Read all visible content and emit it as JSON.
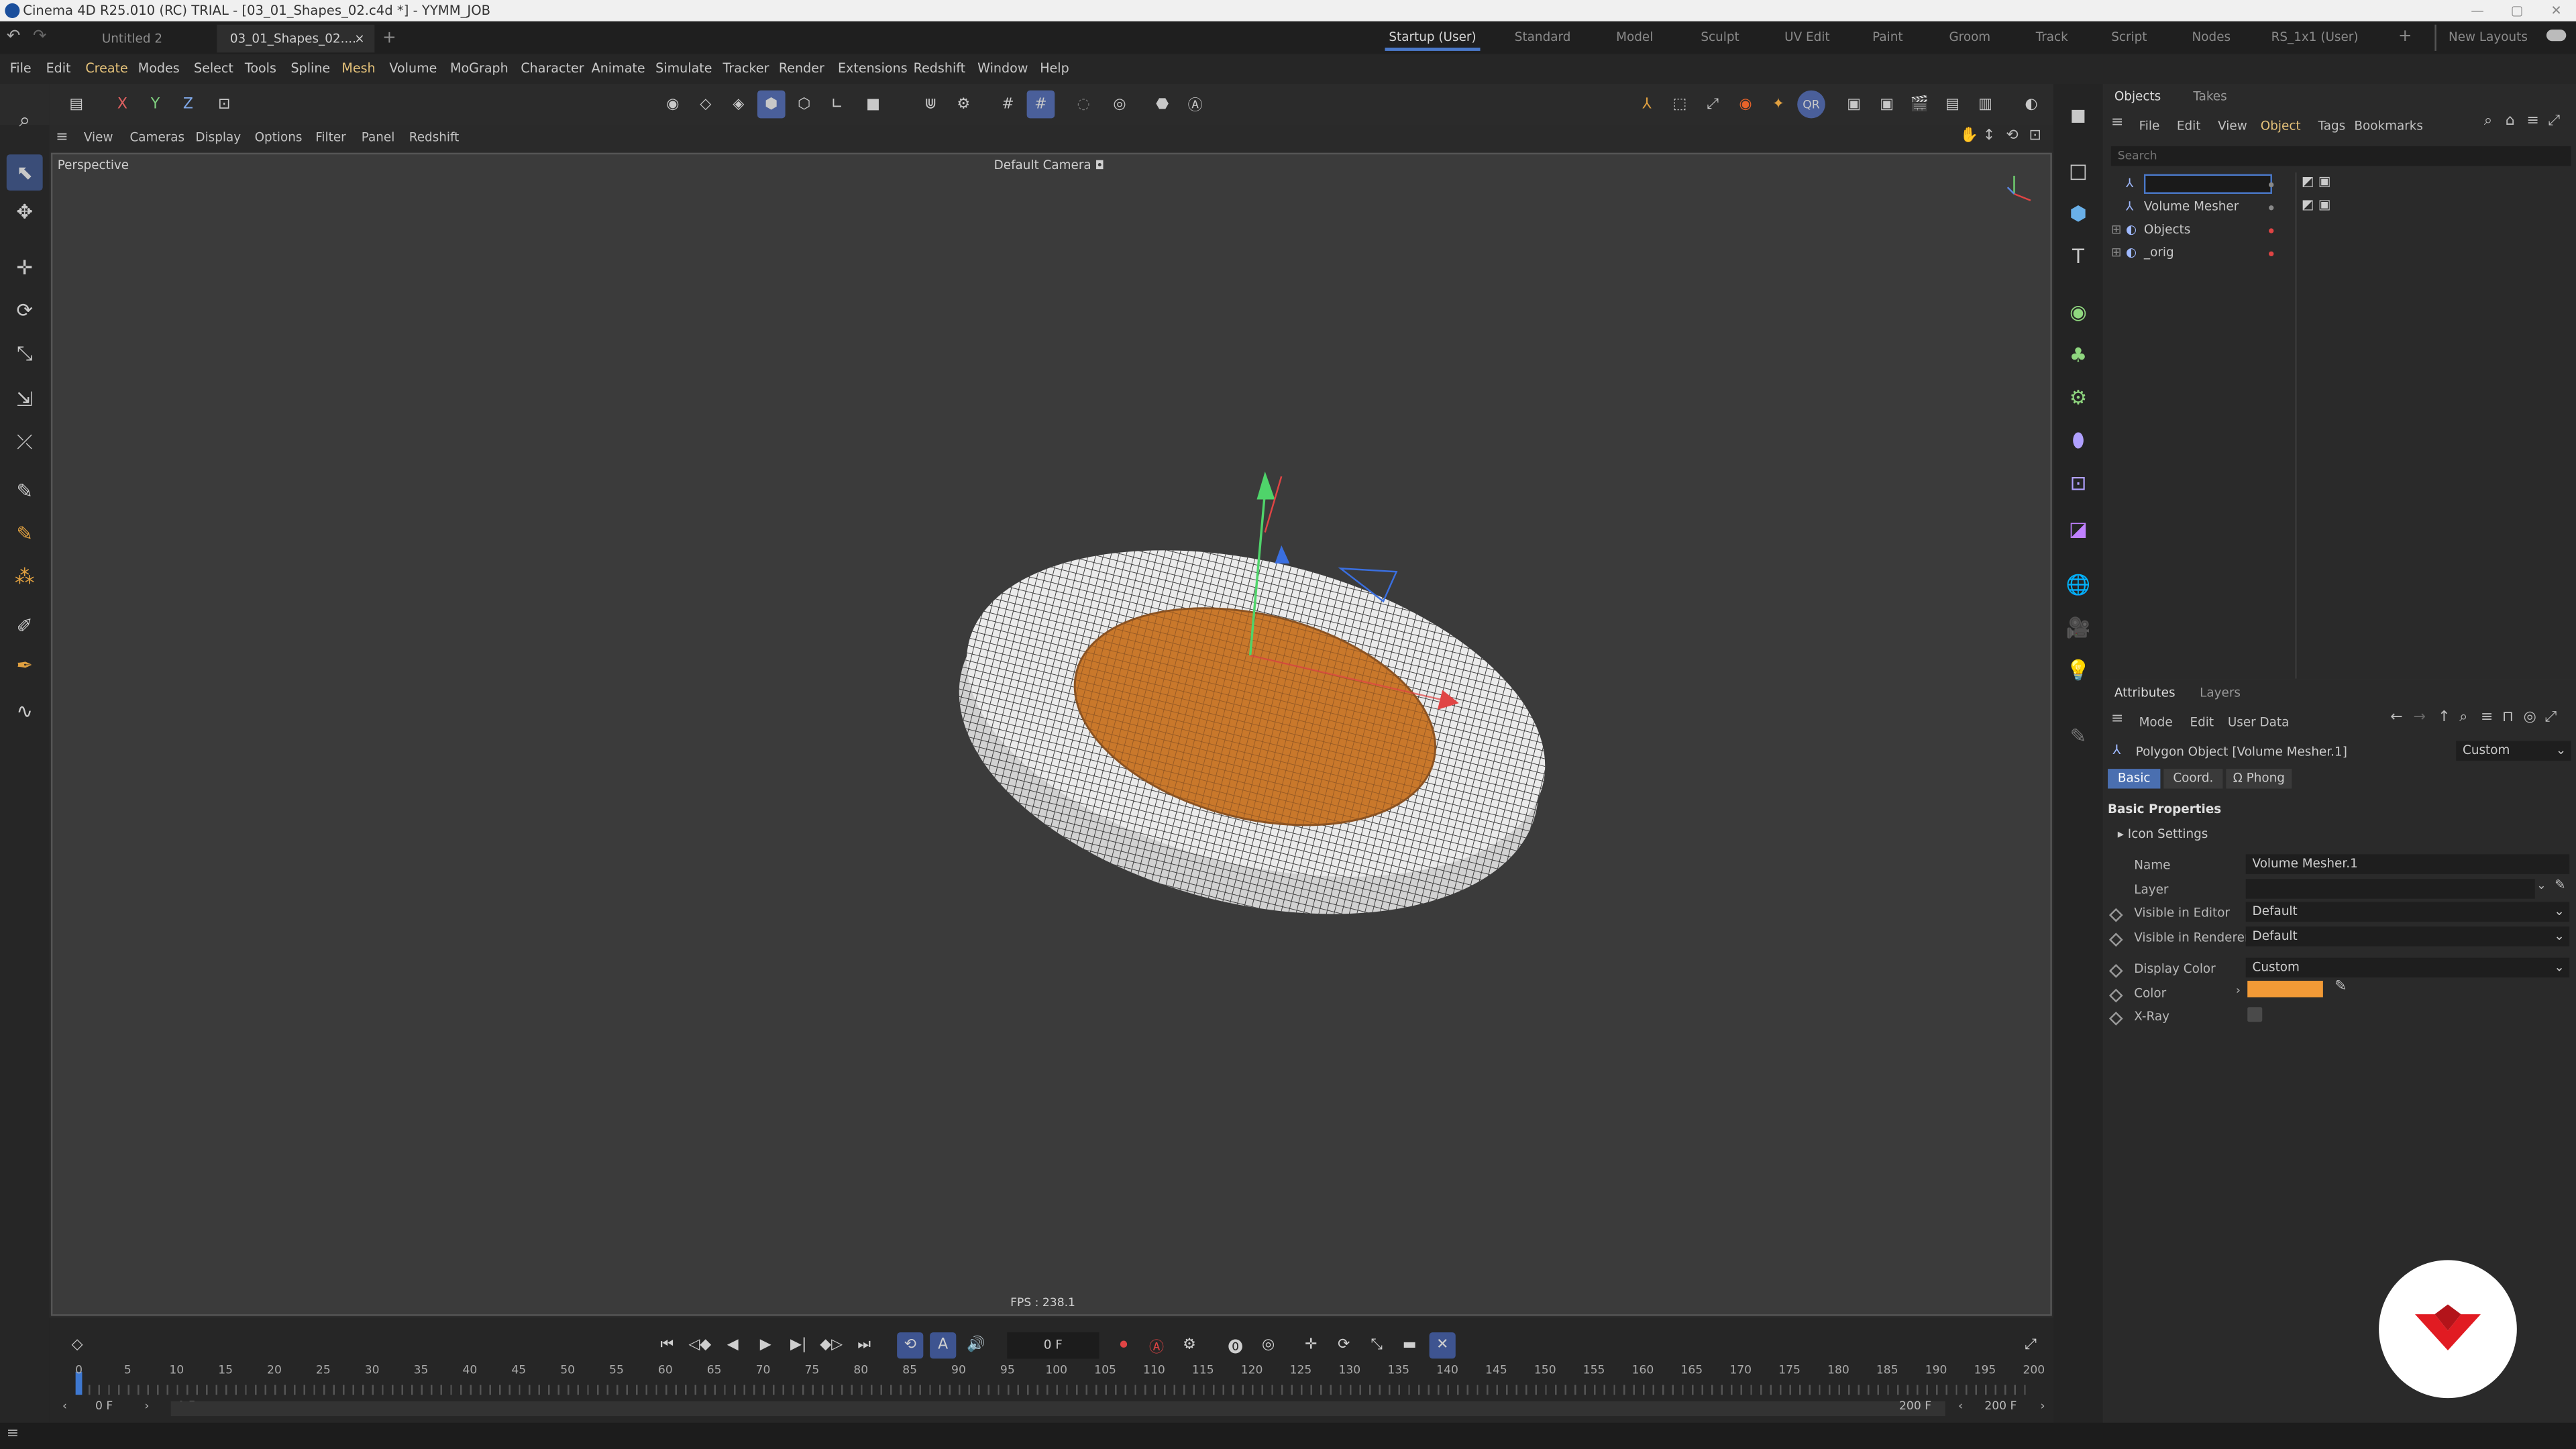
{
  "app": {
    "title": "Cinema 4D R25.010 (RC) TRIAL - [03_01_Shapes_02.c4d *] - YYMM_JOB"
  },
  "doc_tabs": [
    "Untitled 2",
    "03_01_Shapes_02....",
    "×",
    "+"
  ],
  "layouts": [
    "Startup (User)",
    "Standard",
    "Model",
    "Sculpt",
    "UV Edit",
    "Paint",
    "Groom",
    "Track",
    "Script",
    "Nodes",
    "RS_1x1 (User)",
    "+",
    "New Layouts"
  ],
  "menu": [
    "File",
    "Edit",
    "Create",
    "Modes",
    "Select",
    "Tools",
    "Spline",
    "Mesh",
    "Volume",
    "MoGraph",
    "Character",
    "Animate",
    "Simulate",
    "Tracker",
    "Render",
    "Extensions",
    "Redshift",
    "Window",
    "Help"
  ],
  "axis_toggles": [
    "X",
    "Y",
    "Z"
  ],
  "viewport": {
    "menu": [
      "View",
      "Cameras",
      "Display",
      "Options",
      "Filter",
      "Panel",
      "Redshift"
    ],
    "label": "Perspective",
    "camera": "Default Camera",
    "fps": "FPS : 238.1",
    "accent_orange": "#c9782b",
    "mesh_color": "#e8e8e8"
  },
  "timeline": {
    "frame_display": "0 F",
    "start": "0 F",
    "start2": "0 F",
    "end": "200 F",
    "end2": "200 F",
    "ticks": [
      "0",
      "5",
      "10",
      "15",
      "20",
      "25",
      "30",
      "35",
      "40",
      "45",
      "50",
      "55",
      "60",
      "65",
      "70",
      "75",
      "80",
      "85",
      "90",
      "95",
      "100",
      "105",
      "110",
      "115",
      "120",
      "125",
      "130",
      "135",
      "140",
      "145",
      "150",
      "155",
      "160",
      "165",
      "170",
      "175",
      "180",
      "185",
      "190",
      "195",
      "200"
    ]
  },
  "objects_panel": {
    "tabs": [
      "Objects",
      "Takes"
    ],
    "menu": [
      "File",
      "Edit",
      "View",
      "Object",
      "Tags",
      "Bookmarks"
    ],
    "search_placeholder": "Search",
    "rows": [
      {
        "name": ""
      },
      {
        "name": "Volume Mesher"
      },
      {
        "name": "Objects"
      },
      {
        "name": "_orig"
      }
    ]
  },
  "attributes_panel": {
    "tabs": [
      "Attributes",
      "Layers"
    ],
    "menu": [
      "Mode",
      "Edit",
      "User Data"
    ],
    "object_title": "Polygon Object [Volume Mesher.1]",
    "preset": "Custom",
    "subtabs": [
      "Basic",
      "Coord.",
      "Phong"
    ],
    "section": "Basic Properties",
    "icon_settings": "Icon Settings",
    "fields": {
      "name_label": "Name",
      "name_value": "Volume Mesher.1",
      "layer_label": "Layer",
      "layer_value": "",
      "vis_editor_label": "Visible in Editor",
      "vis_editor_value": "Default",
      "vis_render_label": "Visible in Renderer",
      "vis_render_value": "Default",
      "display_color_label": "Display Color",
      "display_color_value": "Custom",
      "color_label": "Color",
      "color_swatch": "#f29a36",
      "xray_label": "X-Ray"
    }
  }
}
